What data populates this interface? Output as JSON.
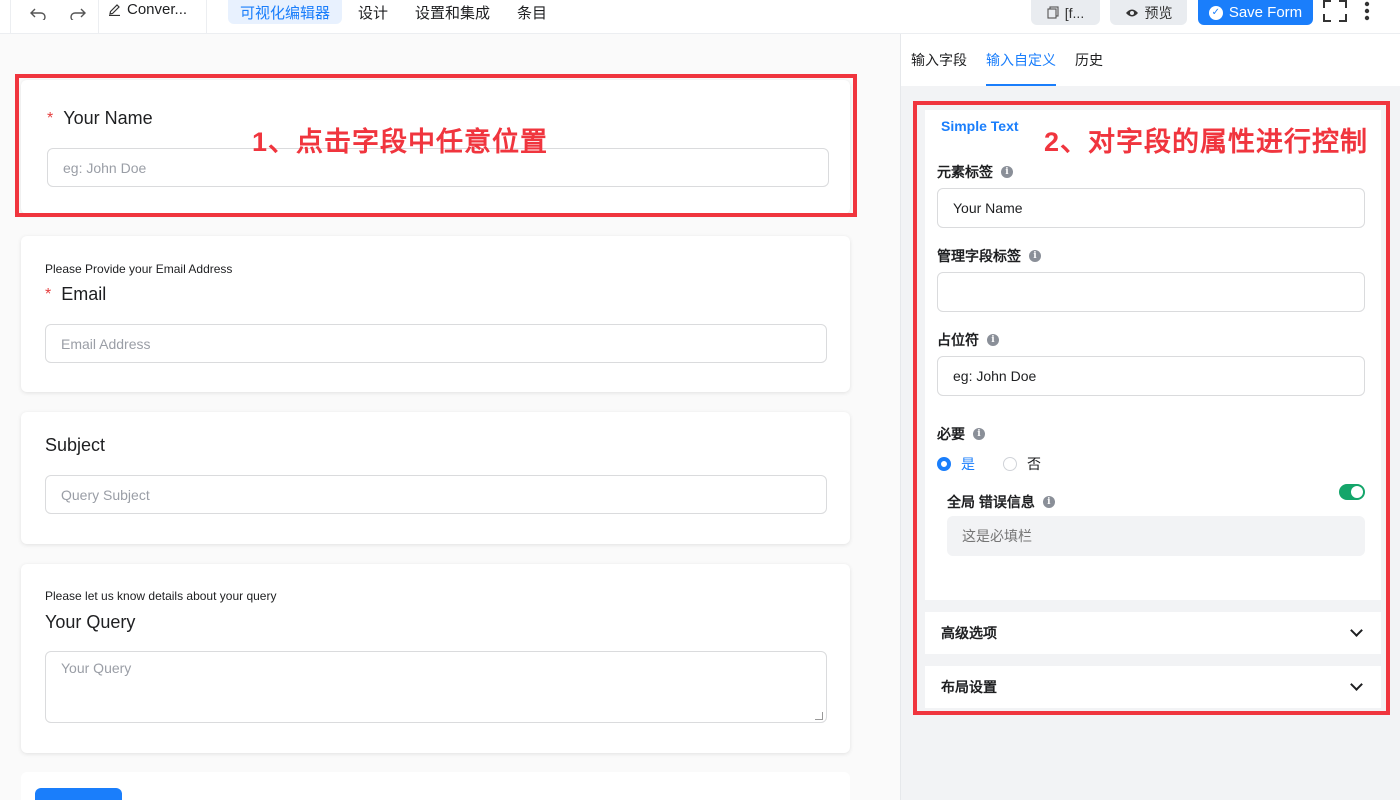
{
  "toolbar": {
    "doc_title": "Conver...",
    "tabs": [
      "可视化编辑器",
      "设计",
      "设置和集成",
      "条目"
    ],
    "shortcode_label": "[f...",
    "preview_label": "预览",
    "save_label": "Save Form"
  },
  "form": {
    "name": {
      "label": "Your Name",
      "placeholder": "eg: John Doe"
    },
    "email": {
      "help": "Please Provide your Email Address",
      "label": "Email",
      "placeholder": "Email Address"
    },
    "subject": {
      "label": "Subject",
      "placeholder": "Query Subject"
    },
    "query": {
      "help": "Please let us know details about your query",
      "label": "Your Query",
      "placeholder": "Your Query"
    }
  },
  "annotations": {
    "step1": "1、点击字段中任意位置",
    "step2": "2、对字段的属性进行控制"
  },
  "panel": {
    "tabs": [
      "输入字段",
      "输入自定义",
      "历史"
    ],
    "section_title": "Simple Text",
    "element_label": {
      "label": "元素标签",
      "value": "Your Name"
    },
    "admin_label": {
      "label": "管理字段标签",
      "value": ""
    },
    "placeholder": {
      "label": "占位符",
      "value": "eg: John Doe"
    },
    "required": {
      "label": "必要",
      "yes": "是",
      "no": "否"
    },
    "global_error": {
      "label": "全局 错误信息",
      "placeholder": "这是必填栏"
    },
    "advanced": "高级选项",
    "layout": "布局设置"
  },
  "colors": {
    "accent": "#1a7efb",
    "annotation": "#f0353e",
    "toggle_on": "#14a56a"
  }
}
